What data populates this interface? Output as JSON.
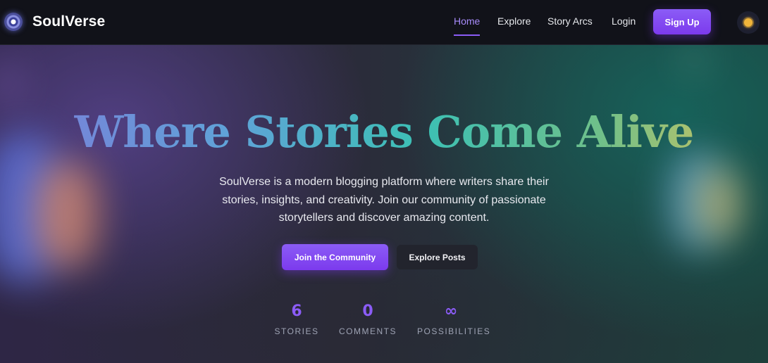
{
  "nav": {
    "brand": "SoulVerse",
    "links": [
      {
        "label": "Home",
        "active": true
      },
      {
        "label": "Explore"
      },
      {
        "label": "Story Arcs"
      },
      {
        "label": "Login"
      }
    ],
    "signup_label": "Sign Up",
    "theme_icon": "sun-icon"
  },
  "hero": {
    "title": "Where Stories Come Alive",
    "description": "SoulVerse is a modern blogging platform where writers share their stories, insights, and creativity. Join our community of passionate storytellers and discover amazing content.",
    "primary_button": "Join the Community",
    "secondary_button": "Explore Posts"
  },
  "stats": [
    {
      "value": "6",
      "label": "STORIES"
    },
    {
      "value": "0",
      "label": "COMMENTS"
    },
    {
      "value": "∞",
      "label": "POSSIBILITIES"
    }
  ],
  "colors": {
    "accent": "#8b5cf6",
    "nav_bg": "#111219",
    "text": "#e5e7eb"
  }
}
